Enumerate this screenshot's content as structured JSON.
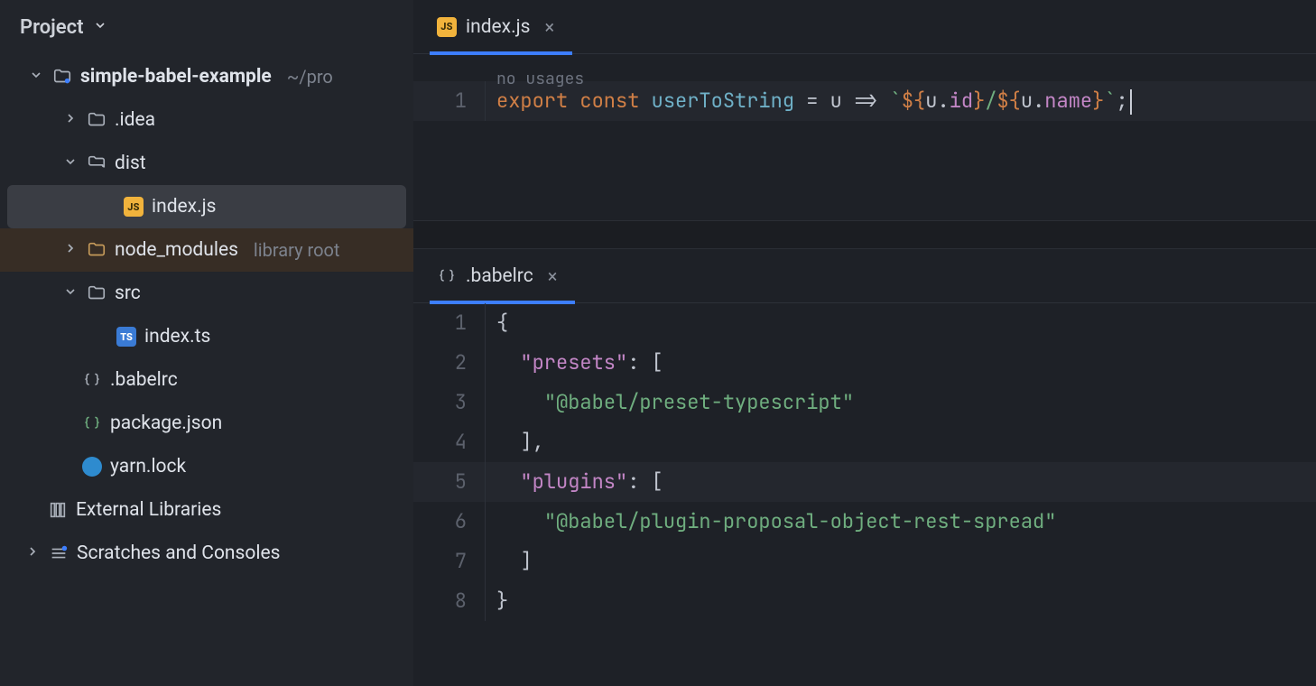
{
  "sidebar": {
    "title": "Project",
    "root": {
      "name": "simple-babel-example",
      "hint": "~/pro"
    },
    "nodes": {
      "idea": ".idea",
      "dist": "dist",
      "dist_index": "index.js",
      "node_modules": "node_modules",
      "node_modules_hint": "library root",
      "src": "src",
      "src_index": "index.ts",
      "babelrc": ".babelrc",
      "package_json": "package.json",
      "yarn_lock": "yarn.lock",
      "external": "External Libraries",
      "scratches": "Scratches and Consoles"
    }
  },
  "editors": {
    "top": {
      "tab": "index.js",
      "usage_hint": "no usages",
      "line_no": "1",
      "tokens": {
        "export": "export",
        "const": "const",
        "fn": "userToString",
        "eq": " = ",
        "param": "u",
        "arrow": " => ",
        "btick1": "`",
        "tpl1": "${",
        "u1": "u",
        "dot1": ".",
        "id": "id",
        "tpl1c": "}",
        "slash": "/",
        "tpl2": "${",
        "u2": "u",
        "dot2": ".",
        "name": "name",
        "tpl2c": "}",
        "btick2": "`",
        "semi": ";"
      }
    },
    "bottom": {
      "tab": ".babelrc",
      "lines": {
        "l1_no": "1",
        "l1": "{",
        "l2_no": "2",
        "l2_key": "\"presets\"",
        "l2_rest": ": [",
        "l3_no": "3",
        "l3_str": "\"@babel/preset-typescript\"",
        "l4_no": "4",
        "l4": "],",
        "l5_no": "5",
        "l5_key": "\"plugins\"",
        "l5_rest": ": [",
        "l6_no": "6",
        "l6_str": "\"@babel/plugin-proposal-object-rest-spread\"",
        "l7_no": "7",
        "l7": "]",
        "l8_no": "8",
        "l8": "}"
      }
    }
  }
}
